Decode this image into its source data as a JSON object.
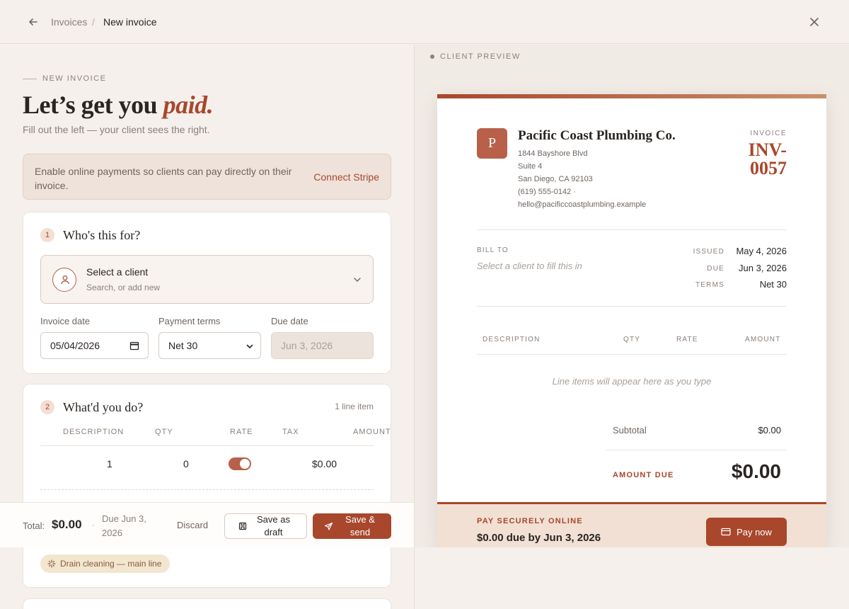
{
  "breadcrumb": {
    "parent": "Invoices",
    "separator": "/",
    "current": "New invoice"
  },
  "intro": {
    "eyebrow": "NEW INVOICE",
    "title_start": "Let’s get you ",
    "title_emphasis": "paid.",
    "subtitle": "Fill out the left — your client sees the right."
  },
  "stripe_banner": {
    "text": "Enable online payments so clients can pay directly on their invoice.",
    "link": "Connect Stripe"
  },
  "section1": {
    "number": "1",
    "title": "Who's this for?",
    "client_select": {
      "title": "Select a client",
      "subtitle": "Search, or add new"
    },
    "invoice_date": {
      "label": "Invoice date",
      "value": "05/04/2026"
    },
    "payment_terms": {
      "label": "Payment terms",
      "value": "Net 30"
    },
    "due_date": {
      "label": "Due date",
      "value": "Jun 3, 2026"
    }
  },
  "section2": {
    "number": "2",
    "title": "What'd you do?",
    "line_count": "1 line item",
    "columns": [
      "DESCRIPTION",
      "QTY",
      "RATE",
      "TAX",
      "AMOUNT"
    ],
    "row": {
      "qty": "1",
      "rate": "0",
      "tax_enabled": true,
      "amount": "$0.00"
    },
    "suggestion_chip": "Drain cleaning — main line"
  },
  "footer": {
    "total_label": "Total:",
    "total": "$0.00",
    "separator": "·",
    "due": "Due Jun 3, 2026",
    "discard": "Discard",
    "save_draft": "Save as draft",
    "save_send": "Save & send"
  },
  "preview": {
    "label": "CLIENT PREVIEW",
    "logo_letter": "P",
    "company": "Pacific Coast Plumbing Co.",
    "address": [
      "1844 Bayshore Blvd",
      "Suite 4",
      "San Diego, CA 92103",
      "(619) 555-0142 ·",
      "hello@pacificcoastplumbing.example"
    ],
    "invoice_label": "INVOICE",
    "invoice_number": "INV-0057",
    "bill_to_label": "BILL TO",
    "bill_to_placeholder": "Select a client to fill this in",
    "issued_label": "ISSUED",
    "issued": "May 4, 2026",
    "due_label": "DUE",
    "due": "Jun 3, 2026",
    "terms_label": "TERMS",
    "terms": "Net 30",
    "table_columns": [
      "DESCRIPTION",
      "QTY",
      "RATE",
      "AMOUNT"
    ],
    "empty_items": "Line items will appear here as you type",
    "subtotal_label": "Subtotal",
    "subtotal": "$0.00",
    "amount_due_label": "AMOUNT DUE",
    "amount_due": "$0.00",
    "pay_label": "PAY SECURELY ONLINE",
    "pay_amount": "$0.00 due by Jun 3, 2026",
    "pay_button": "Pay now"
  },
  "colors": {
    "accent": "#a8472c",
    "background": "#f5f0ec",
    "card": "#ffffff"
  }
}
